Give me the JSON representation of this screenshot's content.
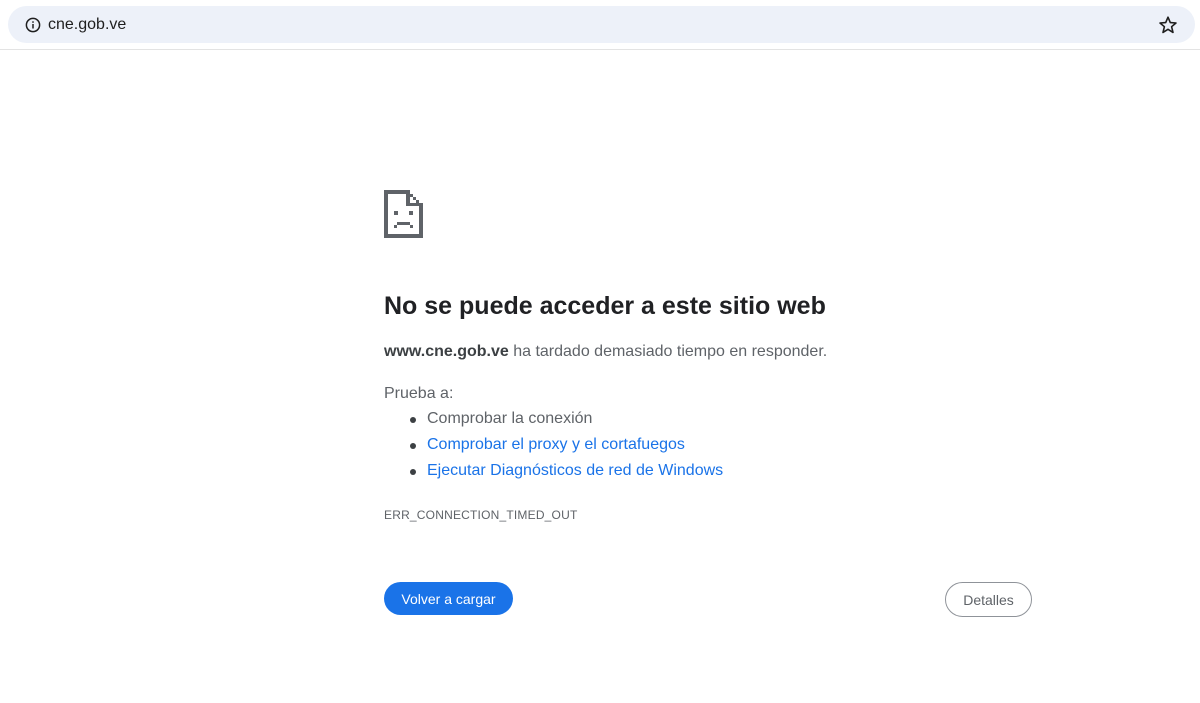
{
  "browser": {
    "url": "cne.gob.ve",
    "info_icon": "info-icon",
    "bookmark_icon": "star-icon"
  },
  "error_page": {
    "icon": "sad-page-icon",
    "heading": "No se puede acceder a este sitio web",
    "summary_host": "www.cne.gob.ve",
    "summary_rest": " ha tardado demasiado tiempo en responder.",
    "suggestions_intro": "Prueba a:",
    "suggestions": [
      "Comprobar la conexión",
      "Comprobar el proxy y el cortafuegos",
      "Ejecutar Diagnósticos de red de Windows"
    ],
    "error_code": "ERR_CONNECTION_TIMED_OUT",
    "reload_label": "Volver a cargar",
    "details_label": "Detalles"
  },
  "colors": {
    "accent": "#1a73e8",
    "omnibox_bg": "#edf1f9",
    "text_secondary": "#5f6368",
    "heading": "#202124"
  }
}
